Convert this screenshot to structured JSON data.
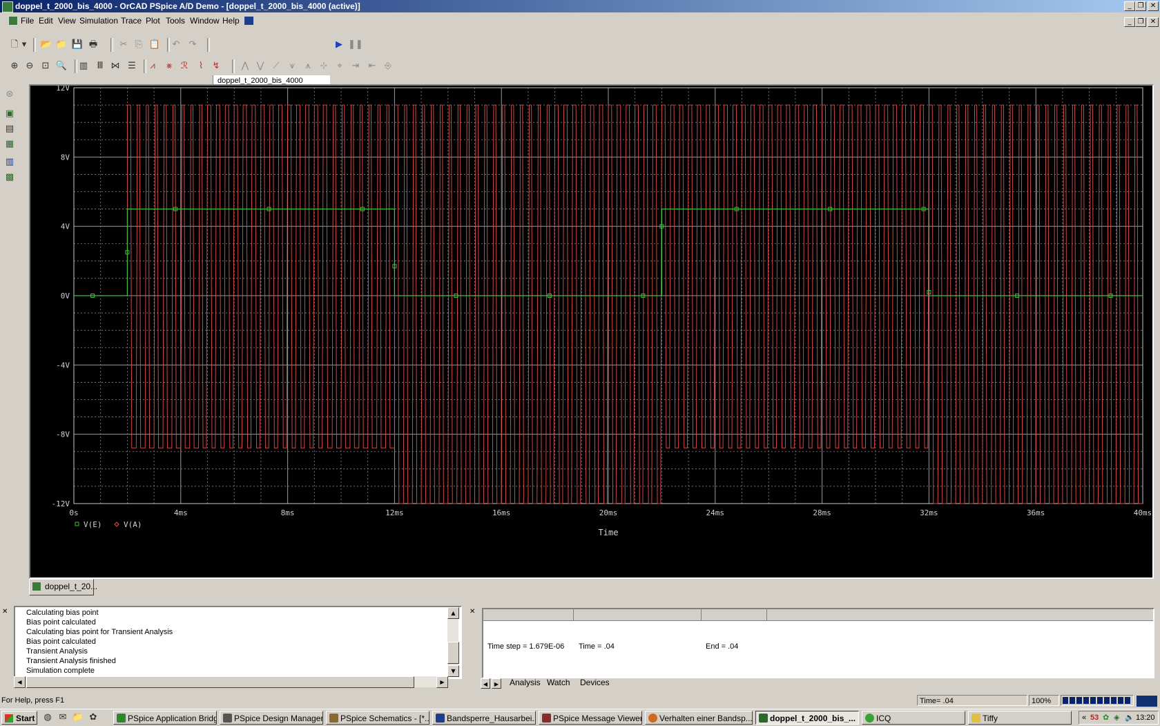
{
  "window": {
    "title": "doppel_t_2000_bis_4000 - OrCAD PSpice A/D Demo - [doppel_t_2000_bis_4000 (active)]"
  },
  "menubar": [
    "File",
    "Edit",
    "View",
    "Simulation",
    "Trace",
    "Plot",
    "Tools",
    "Window",
    "Help"
  ],
  "toolbar": {
    "profile_value": "doppel_t_2000_bis_4000"
  },
  "chart_data": {
    "type": "line",
    "xlabel": "Time",
    "xlim": [
      0,
      40
    ],
    "ylim": [
      -12,
      12
    ],
    "x_ticks": [
      "0s",
      "4ms",
      "8ms",
      "12ms",
      "16ms",
      "20ms",
      "24ms",
      "28ms",
      "32ms",
      "36ms",
      "40ms"
    ],
    "y_ticks": [
      "12V",
      "8V",
      "4V",
      "0V",
      "-4V",
      "-8V",
      "-12V"
    ],
    "grid": true,
    "legend_position": "bottom-left",
    "series": [
      {
        "name": "V(E)",
        "color": "#3fbf3f",
        "marker": "square",
        "x": [
          0,
          2,
          2,
          12,
          12,
          22,
          22,
          32,
          32,
          40
        ],
        "y": [
          0,
          0,
          5,
          5,
          0,
          0,
          5,
          5,
          0,
          0
        ]
      },
      {
        "name": "V(A)",
        "color": "#e05050",
        "marker": "diamond",
        "description_segments": [
          {
            "t_start": 0,
            "t_end": 2,
            "mode": "flat",
            "level": 0
          },
          {
            "t_start": 2,
            "t_end": 12,
            "mode": "oscillation",
            "min": -8.8,
            "max": 11
          },
          {
            "t_start": 12,
            "t_end": 22,
            "mode": "oscillation",
            "min": -12,
            "max": 11
          },
          {
            "t_start": 22,
            "t_end": 32,
            "mode": "oscillation",
            "min": -8.8,
            "max": 11
          },
          {
            "t_start": 32,
            "t_end": 40,
            "mode": "oscillation",
            "min": -12,
            "max": 11
          }
        ],
        "frequency_hz": 3000
      }
    ]
  },
  "document_tab": {
    "label": "doppel_t_20..."
  },
  "output_log": [
    "Calculating bias point",
    "Bias point calculated",
    "Calculating bias point for Transient Analysis",
    "Bias point calculated",
    "Transient Analysis",
    "Transient Analysis finished",
    "Simulation complete"
  ],
  "status_pane": {
    "time_step": "Time step =  1.679E-06",
    "time": "Time =  .04",
    "end": "End =  .04"
  },
  "status_tabs": [
    "Analysis",
    "Watch",
    "Devices"
  ],
  "statusbar": {
    "help": "For Help, press F1",
    "time": "Time= .04",
    "zoom": "100%"
  },
  "taskbar": {
    "start": "Start",
    "tasks": [
      "PSpice Application Bridge",
      "PSpice Design Manager...",
      "PSpice Schematics - [*...",
      "Bandsperre_Hausarbei...",
      "PSpice Message Viewer...",
      "Verhalten einer Bandsp...",
      "doppel_t_2000_bis_...",
      "ICQ",
      "Tiffy"
    ],
    "tray_count": "53",
    "clock": "13:20"
  }
}
